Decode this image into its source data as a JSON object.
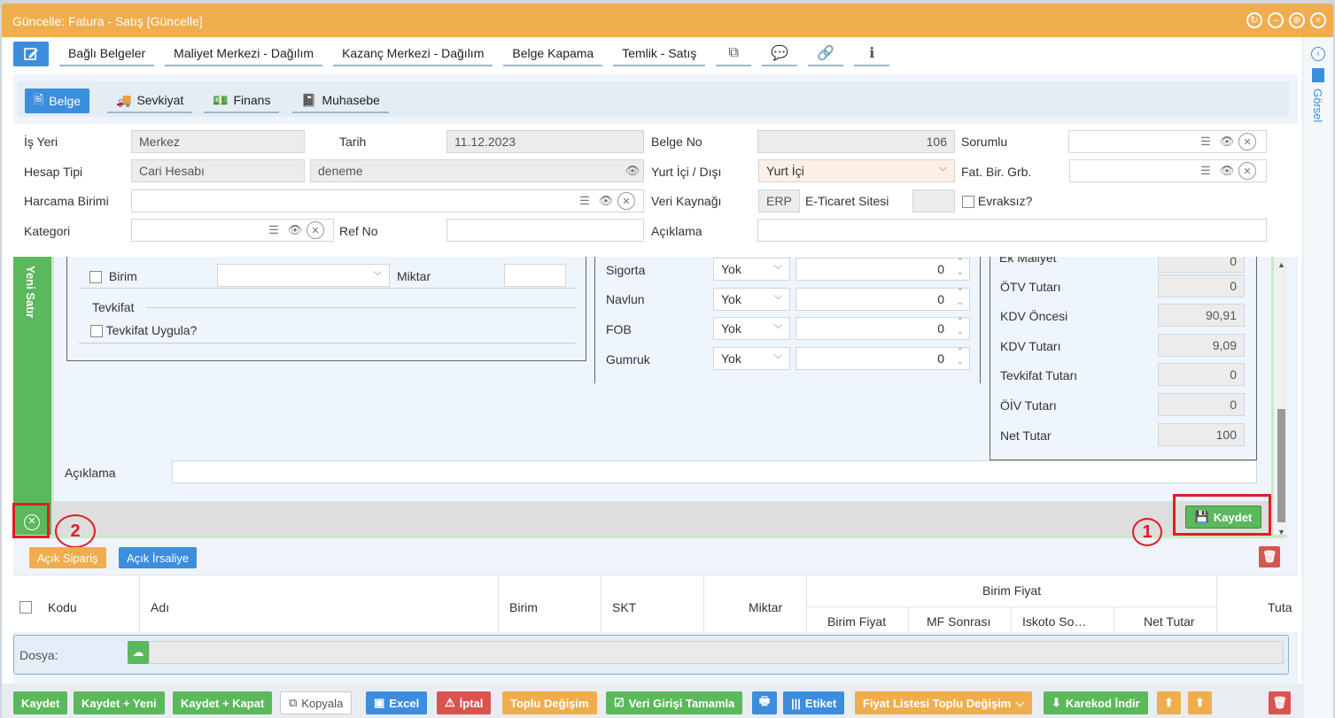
{
  "window": {
    "title": "Güncelle: Fatura - Satış [Güncelle]"
  },
  "toolbar": {
    "items": [
      "Bağlı Belgeler",
      "Maliyet Merkezi - Dağılım",
      "Kazanç Merkezi - Dağılım",
      "Belge Kapama",
      "Temlik - Satış"
    ]
  },
  "side": {
    "gorsel": "Görsel"
  },
  "tabs": [
    "Belge",
    "Sevkiyat",
    "Finans",
    "Muhasebe"
  ],
  "form": {
    "is_yeri_label": "İş Yeri",
    "is_yeri": "Merkez",
    "tarih_label": "Tarih",
    "tarih": "11.12.2023",
    "belge_no_label": "Belge No",
    "belge_no": "106",
    "sorumlu_label": "Sorumlu",
    "hesap_tipi_label": "Hesap Tipi",
    "hesap_tipi": "Cari Hesabı",
    "hesap": "deneme",
    "yurt_label": "Yurt İçi / Dışı",
    "yurt": "Yurt İçi",
    "fat_label": "Fat. Bir. Grb.",
    "harcama_label": "Harcama Birimi",
    "veri_label": "Veri Kaynağı",
    "veri": "ERP",
    "eticaret_label": "E-Ticaret Sitesi",
    "evraksiz_label": "Evraksız?",
    "kategori_label": "Kategori",
    "refno_label": "Ref No",
    "aciklama_label": "Açıklama"
  },
  "line": {
    "yeni_satir": "Yeni Satır",
    "birim_label": "Birim",
    "miktar_label": "Miktar",
    "tevkifat_title": "Tevkifat",
    "tevkifat_uygula": "Tevkifat Uygula?",
    "costs": [
      {
        "label": "Sigorta",
        "select": "Yok",
        "value": "0"
      },
      {
        "label": "Navlun",
        "select": "Yok",
        "value": "0"
      },
      {
        "label": "FOB",
        "select": "Yok",
        "value": "0"
      },
      {
        "label": "Gumruk",
        "select": "Yok",
        "value": "0"
      }
    ],
    "ek_maliyet_label": "Ek Maliyet",
    "ek_maliyet": "0",
    "totals": [
      {
        "label": "ÖTV Tutarı",
        "value": "0"
      },
      {
        "label": "KDV Öncesi",
        "value": "90,91"
      },
      {
        "label": "KDV Tutarı",
        "value": "9,09"
      },
      {
        "label": "Tevkifat Tutarı",
        "value": "0"
      },
      {
        "label": "ÖİV Tutarı",
        "value": "0"
      },
      {
        "label": "Net Tutar",
        "value": "100"
      }
    ],
    "aciklama_label": "Açıklama",
    "kaydet": "Kaydet"
  },
  "annotations": {
    "one": "1",
    "two": "2"
  },
  "grid": {
    "acik_siparis": "Açık Sipariş",
    "acik_irsaliye": "Açık İrsaliye",
    "cols": {
      "kodu": "Kodu",
      "adi": "Adı",
      "birim": "Birim",
      "skt": "SKT",
      "miktar": "Miktar",
      "birim_fiyat_group": "Birim Fiyat",
      "birim_fiyat": "Birim Fiyat",
      "mf_sonrasi": "MF Sonrası",
      "iskoto": "Iskoto So…",
      "net_tutar": "Net Tutar",
      "tutar": "Tuta"
    }
  },
  "dosya": {
    "label": "Dosya:"
  },
  "footer": {
    "kaydet": "Kaydet",
    "kaydet_yeni": "Kaydet + Yeni",
    "kaydet_kapat": "Kaydet + Kapat",
    "kopyala": "Kopyala",
    "excel": "Excel",
    "iptal": "İptal",
    "toplu": "Toplu Değişim",
    "veri": "Veri Girişi Tamamla",
    "etiket": "Etiket",
    "fiyat": "Fiyat Listesi Toplu Değişim",
    "karekod": "Karekod İndir"
  },
  "colors": {
    "orange": "#f0ad4e",
    "green": "#5cb85c",
    "blue": "#3c8dde",
    "red": "#d9534f"
  }
}
